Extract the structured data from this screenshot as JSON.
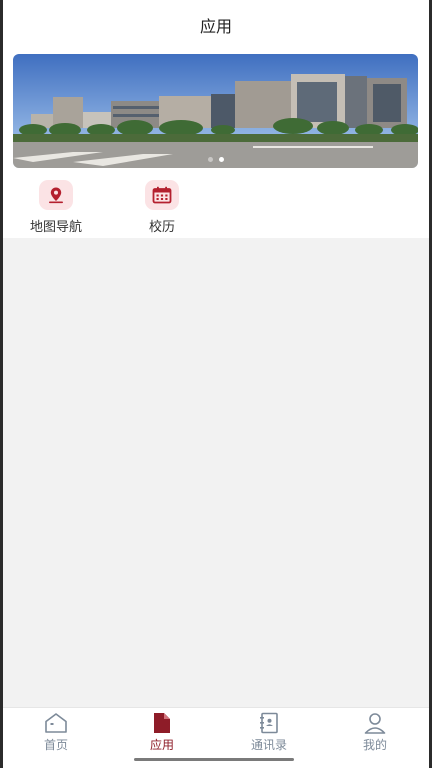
{
  "header": {
    "title": "应用"
  },
  "banner": {
    "image": "campus-building-photo",
    "slides": 2,
    "active_slide": 1
  },
  "apps": [
    {
      "label": "地图导航",
      "icon": "map-pin-icon"
    },
    {
      "label": "校历",
      "icon": "calendar-icon"
    }
  ],
  "tabs": [
    {
      "label": "首页",
      "icon": "home-icon",
      "active": false
    },
    {
      "label": "应用",
      "icon": "file-icon",
      "active": true
    },
    {
      "label": "通讯录",
      "icon": "contacts-book-icon",
      "active": false
    },
    {
      "label": "我的",
      "icon": "person-icon",
      "active": false
    }
  ],
  "colors": {
    "accent": "#8e1c28",
    "inactive": "#7d8a99",
    "icon_bg": "#fbe3e5",
    "background": "#f2f2f2"
  }
}
